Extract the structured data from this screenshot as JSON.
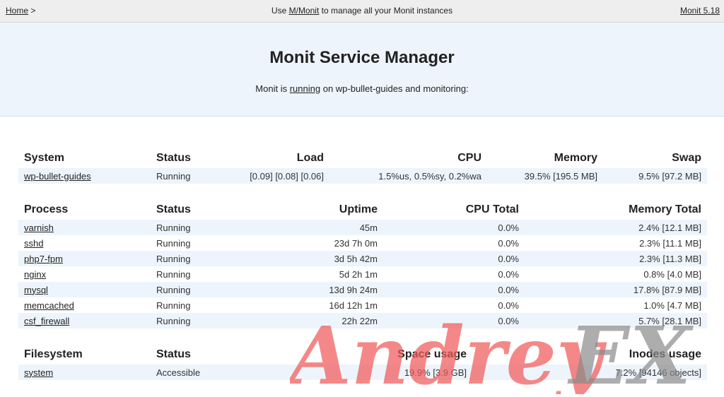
{
  "topbar": {
    "home_label": "Home",
    "home_sep": ">",
    "center_prefix": "Use",
    "center_link": "M/Monit",
    "center_suffix": "to manage all your Monit instances",
    "version": "Monit 5.18"
  },
  "hero": {
    "title": "Monit Service Manager",
    "sub_prefix": "Monit is",
    "sub_link": "running",
    "sub_suffix": "on wp-bullet-guides and monitoring:"
  },
  "system_table": {
    "headers": [
      "System",
      "Status",
      "Load",
      "CPU",
      "Memory",
      "Swap"
    ],
    "rows": [
      {
        "name": "wp-bullet-guides",
        "status": "Running",
        "load": "[0.09] [0.08] [0.06]",
        "cpu": "1.5%us, 0.5%sy, 0.2%wa",
        "memory": "39.5% [195.5 MB]",
        "swap": "9.5% [97.2 MB]"
      }
    ]
  },
  "process_table": {
    "headers": [
      "Process",
      "Status",
      "Uptime",
      "CPU Total",
      "Memory Total"
    ],
    "rows": [
      {
        "name": "varnish",
        "status": "Running",
        "uptime": "45m",
        "cpu": "0.0%",
        "memory": "2.4% [12.1 MB]"
      },
      {
        "name": "sshd",
        "status": "Running",
        "uptime": "23d 7h 0m",
        "cpu": "0.0%",
        "memory": "2.3% [11.1 MB]"
      },
      {
        "name": "php7-fpm",
        "status": "Running",
        "uptime": "3d 5h 42m",
        "cpu": "0.0%",
        "memory": "2.3% [11.3 MB]"
      },
      {
        "name": "nginx",
        "status": "Running",
        "uptime": "5d 2h 1m",
        "cpu": "0.0%",
        "memory": "0.8% [4.0 MB]"
      },
      {
        "name": "mysql",
        "status": "Running",
        "uptime": "13d 9h 24m",
        "cpu": "0.0%",
        "memory": "17.8% [87.9 MB]"
      },
      {
        "name": "memcached",
        "status": "Running",
        "uptime": "16d 12h 1m",
        "cpu": "0.0%",
        "memory": "1.0% [4.7 MB]"
      },
      {
        "name": "csf_firewall",
        "status": "Running",
        "uptime": "22h 22m",
        "cpu": "0.0%",
        "memory": "5.7% [28.1 MB]"
      }
    ]
  },
  "filesystem_table": {
    "headers": [
      "Filesystem",
      "Status",
      "Space usage",
      "Inodes usage"
    ],
    "rows": [
      {
        "name": "system",
        "status": "Accessible",
        "space": "19.9% [3.9 GB]",
        "inodes": "7.2% [94146 objects]"
      }
    ]
  },
  "watermark": {
    "text": "AndreyEX"
  },
  "colors": {
    "status_ok": "#31e131",
    "hero_bg": "#eef4fc",
    "row_alt": "#edf4fc",
    "topbar_bg": "#eeeeee",
    "watermark_red": "#f05a5a",
    "watermark_grey": "#8a8a8a"
  }
}
